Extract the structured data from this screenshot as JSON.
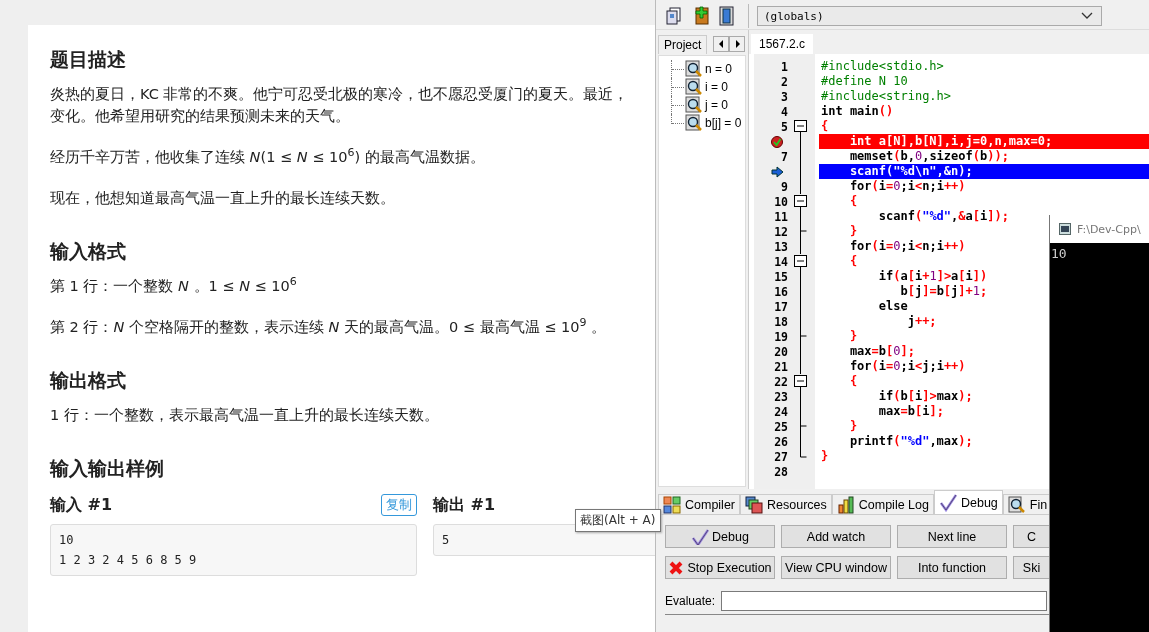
{
  "problem": {
    "sections": [
      {
        "heading": "题目描述",
        "paragraphs": [
          [
            "炎热的夏日，KC 非常的不爽。他宁可忍受北极的寒冷，也不愿忍受厦门的夏天。最近，",
            "变化。他希望用研究的结果预测未来的天气。"
          ],
          [
            "经历千辛万苦，他收集了连续 *N*(1 ≤ *N* ≤ 10$^{6}$) 的最高气温数据。"
          ],
          [
            "现在，他想知道最高气温一直上升的最长连续天数。"
          ]
        ]
      },
      {
        "heading": "输入格式",
        "paragraphs": [
          [
            "第 1 行：一个整数 *N* 。1 ≤ *N* ≤ 10$^{6}$"
          ],
          [
            "第 2 行：*N* 个空格隔开的整数，表示连续 *N* 天的最高气温。0 ≤ 最高气温 ≤ 10$^{9}$ 。"
          ]
        ]
      },
      {
        "heading": "输出格式",
        "paragraphs": [
          [
            "1 行：一个整数，表示最高气温一直上升的最长连续天数。"
          ]
        ]
      }
    ],
    "samples": {
      "heading": "输入输出样例",
      "input": {
        "label": "输入 #1",
        "copy": "复制",
        "lines": [
          "10",
          "1 2 3 2 4 5 6 8 5 9"
        ]
      },
      "output": {
        "label": "输出 #1",
        "lines": [
          "5"
        ]
      }
    }
  },
  "tooltip": "截图(Alt + A)",
  "ide": {
    "scope": "(globals)",
    "project_tab": "Project",
    "watches": [
      "n = 0",
      "i = 0",
      "j = 0",
      "b[j] = 0"
    ],
    "file_tab": "1567.2.c",
    "code": [
      {
        "number": "1",
        "breakpoint": false,
        "current": false,
        "kind": "plain",
        "tokens": [
          {
            "text": "#include<stdio.h>",
            "kind": "pre"
          }
        ]
      },
      {
        "number": "2",
        "breakpoint": false,
        "current": false,
        "kind": "plain",
        "tokens": [
          {
            "text": "#define N 10",
            "kind": "pre"
          }
        ]
      },
      {
        "number": "3",
        "breakpoint": false,
        "current": false,
        "kind": "plain",
        "tokens": [
          {
            "text": "#include<string.h>",
            "kind": "pre"
          }
        ]
      },
      {
        "number": "4",
        "breakpoint": false,
        "current": false,
        "kind": "plain",
        "tokens": [
          {
            "text": "int main",
            "kind": "word"
          },
          {
            "text": "()",
            "kind": "sym"
          }
        ]
      },
      {
        "number": "5",
        "breakpoint": false,
        "current": false,
        "kind": "open",
        "tokens": [
          {
            "text": "{",
            "kind": "sym"
          }
        ]
      },
      {
        "breakpoint": true,
        "current": false,
        "kind": "inner",
        "tokens": [
          {
            "text": "    int a[N],b[N],i,j=0,n,max=0;",
            "kind": "word"
          }
        ]
      },
      {
        "number": "7",
        "breakpoint": false,
        "current": false,
        "kind": "inner",
        "tokens": [
          {
            "text": "    memset",
            "kind": "word"
          },
          {
            "text": "(",
            "kind": "sym"
          },
          {
            "text": "b,",
            "kind": "word"
          },
          {
            "text": "0",
            "kind": "num"
          },
          {
            "text": ",sizeof",
            "kind": "word"
          },
          {
            "text": "(",
            "kind": "sym"
          },
          {
            "text": "b",
            "kind": "word"
          },
          {
            "text": "));",
            "kind": "sym"
          }
        ]
      },
      {
        "breakpoint": false,
        "current": true,
        "kind": "inner",
        "tokens": [
          {
            "text": "    scanf(\"%d\\n\",&n);",
            "kind": "word"
          }
        ]
      },
      {
        "number": "9",
        "breakpoint": false,
        "current": false,
        "kind": "inner",
        "tokens": [
          {
            "text": "    for",
            "kind": "word"
          },
          {
            "text": "(",
            "kind": "sym"
          },
          {
            "text": "i",
            "kind": "word"
          },
          {
            "text": "=",
            "kind": "sym"
          },
          {
            "text": "0",
            "kind": "num"
          },
          {
            "text": ";i",
            "kind": "word"
          },
          {
            "text": "<",
            "kind": "sym"
          },
          {
            "text": "n;i",
            "kind": "word"
          },
          {
            "text": "++)",
            "kind": "sym"
          }
        ]
      },
      {
        "number": "10",
        "breakpoint": false,
        "current": false,
        "kind": "open",
        "tokens": [
          {
            "text": "    {",
            "kind": "sym"
          }
        ]
      },
      {
        "number": "11",
        "breakpoint": false,
        "current": false,
        "kind": "inner",
        "tokens": [
          {
            "text": "        scanf",
            "kind": "word"
          },
          {
            "text": "(",
            "kind": "sym"
          },
          {
            "text": "\"%d\"",
            "kind": "str"
          },
          {
            "text": ",",
            "kind": "word"
          },
          {
            "text": "&",
            "kind": "sym"
          },
          {
            "text": "a",
            "kind": "word"
          },
          {
            "text": "[",
            "kind": "sym"
          },
          {
            "text": "i",
            "kind": "word"
          },
          {
            "text": "]);",
            "kind": "sym"
          }
        ]
      },
      {
        "number": "12",
        "breakpoint": false,
        "current": false,
        "kind": "close",
        "tokens": [
          {
            "text": "    }",
            "kind": "sym"
          }
        ]
      },
      {
        "number": "13",
        "breakpoint": false,
        "current": false,
        "kind": "inner",
        "tokens": [
          {
            "text": "    for",
            "kind": "word"
          },
          {
            "text": "(",
            "kind": "sym"
          },
          {
            "text": "i",
            "kind": "word"
          },
          {
            "text": "=",
            "kind": "sym"
          },
          {
            "text": "0",
            "kind": "num"
          },
          {
            "text": ";i",
            "kind": "word"
          },
          {
            "text": "<",
            "kind": "sym"
          },
          {
            "text": "n;i",
            "kind": "word"
          },
          {
            "text": "++)",
            "kind": "sym"
          }
        ]
      },
      {
        "number": "14",
        "breakpoint": false,
        "current": false,
        "kind": "open",
        "tokens": [
          {
            "text": "    {",
            "kind": "sym"
          }
        ]
      },
      {
        "number": "15",
        "breakpoint": false,
        "current": false,
        "kind": "inner",
        "tokens": [
          {
            "text": "        if",
            "kind": "word"
          },
          {
            "text": "(",
            "kind": "sym"
          },
          {
            "text": "a",
            "kind": "word"
          },
          {
            "text": "[",
            "kind": "sym"
          },
          {
            "text": "i",
            "kind": "word"
          },
          {
            "text": "+",
            "kind": "sym"
          },
          {
            "text": "1",
            "kind": "num"
          },
          {
            "text": "]>",
            "kind": "sym"
          },
          {
            "text": "a",
            "kind": "word"
          },
          {
            "text": "[",
            "kind": "sym"
          },
          {
            "text": "i",
            "kind": "word"
          },
          {
            "text": "])",
            "kind": "sym"
          }
        ]
      },
      {
        "number": "16",
        "breakpoint": false,
        "current": false,
        "kind": "inner",
        "tokens": [
          {
            "text": "           b",
            "kind": "word"
          },
          {
            "text": "[",
            "kind": "sym"
          },
          {
            "text": "j",
            "kind": "word"
          },
          {
            "text": "]=",
            "kind": "sym"
          },
          {
            "text": "b",
            "kind": "word"
          },
          {
            "text": "[",
            "kind": "sym"
          },
          {
            "text": "j",
            "kind": "word"
          },
          {
            "text": "]+",
            "kind": "sym"
          },
          {
            "text": "1",
            "kind": "num"
          },
          {
            "text": ";",
            "kind": "sym"
          }
        ]
      },
      {
        "number": "17",
        "breakpoint": false,
        "current": false,
        "kind": "inner",
        "tokens": [
          {
            "text": "        else",
            "kind": "word"
          }
        ]
      },
      {
        "number": "18",
        "breakpoint": false,
        "current": false,
        "kind": "inner",
        "tokens": [
          {
            "text": "            j",
            "kind": "word"
          },
          {
            "text": "++;",
            "kind": "sym"
          }
        ]
      },
      {
        "number": "19",
        "breakpoint": false,
        "current": false,
        "kind": "close",
        "tokens": [
          {
            "text": "    }",
            "kind": "sym"
          }
        ]
      },
      {
        "number": "20",
        "breakpoint": false,
        "current": false,
        "kind": "inner",
        "tokens": [
          {
            "text": "    max",
            "kind": "word"
          },
          {
            "text": "=",
            "kind": "sym"
          },
          {
            "text": "b",
            "kind": "word"
          },
          {
            "text": "[",
            "kind": "sym"
          },
          {
            "text": "0",
            "kind": "num"
          },
          {
            "text": "];",
            "kind": "sym"
          }
        ]
      },
      {
        "number": "21",
        "breakpoint": false,
        "current": false,
        "kind": "inner",
        "tokens": [
          {
            "text": "    for",
            "kind": "word"
          },
          {
            "text": "(",
            "kind": "sym"
          },
          {
            "text": "i",
            "kind": "word"
          },
          {
            "text": "=",
            "kind": "sym"
          },
          {
            "text": "0",
            "kind": "num"
          },
          {
            "text": ";i",
            "kind": "word"
          },
          {
            "text": "<",
            "kind": "sym"
          },
          {
            "text": "j;i",
            "kind": "word"
          },
          {
            "text": "++)",
            "kind": "sym"
          }
        ]
      },
      {
        "number": "22",
        "breakpoint": false,
        "current": false,
        "kind": "open",
        "tokens": [
          {
            "text": "    {",
            "kind": "sym"
          }
        ]
      },
      {
        "number": "23",
        "breakpoint": false,
        "current": false,
        "kind": "inner",
        "tokens": [
          {
            "text": "        if",
            "kind": "word"
          },
          {
            "text": "(",
            "kind": "sym"
          },
          {
            "text": "b",
            "kind": "word"
          },
          {
            "text": "[",
            "kind": "sym"
          },
          {
            "text": "i",
            "kind": "word"
          },
          {
            "text": "]>",
            "kind": "sym"
          },
          {
            "text": "max",
            "kind": "word"
          },
          {
            "text": ");",
            "kind": "sym"
          }
        ]
      },
      {
        "number": "24",
        "breakpoint": false,
        "current": false,
        "kind": "inner",
        "tokens": [
          {
            "text": "        max",
            "kind": "word"
          },
          {
            "text": "=",
            "kind": "sym"
          },
          {
            "text": "b",
            "kind": "word"
          },
          {
            "text": "[",
            "kind": "sym"
          },
          {
            "text": "i",
            "kind": "word"
          },
          {
            "text": "];",
            "kind": "sym"
          }
        ]
      },
      {
        "number": "25",
        "breakpoint": false,
        "current": false,
        "kind": "close",
        "tokens": [
          {
            "text": "    }",
            "kind": "sym"
          }
        ]
      },
      {
        "number": "26",
        "breakpoint": false,
        "current": false,
        "kind": "inner",
        "tokens": [
          {
            "text": "    printf",
            "kind": "word"
          },
          {
            "text": "(",
            "kind": "sym"
          },
          {
            "text": "\"%d\"",
            "kind": "str"
          },
          {
            "text": ",max",
            "kind": "word"
          },
          {
            "text": ");",
            "kind": "sym"
          }
        ]
      },
      {
        "number": "27",
        "breakpoint": false,
        "current": false,
        "kind": "end",
        "tokens": [
          {
            "text": "}",
            "kind": "sym"
          }
        ]
      },
      {
        "number": "28",
        "kind": "plain"
      }
    ],
    "bottom_tabs": [
      {
        "label": "Compiler",
        "selected": false
      },
      {
        "label": "Resources",
        "selected": false
      },
      {
        "label": "Compile Log",
        "selected": false
      },
      {
        "label": "Debug",
        "selected": true
      },
      {
        "label": "Fin",
        "selected": false
      }
    ],
    "buttons": [
      [
        "Debug",
        "Add watch",
        "Next line",
        "C"
      ],
      [
        "Stop Execution",
        "View CPU window",
        "Into function",
        "Ski"
      ]
    ],
    "evaluate": {
      "label": "Evaluate:"
    }
  },
  "console": {
    "title": "F:\\Dev-Cpp\\",
    "output": "10"
  }
}
